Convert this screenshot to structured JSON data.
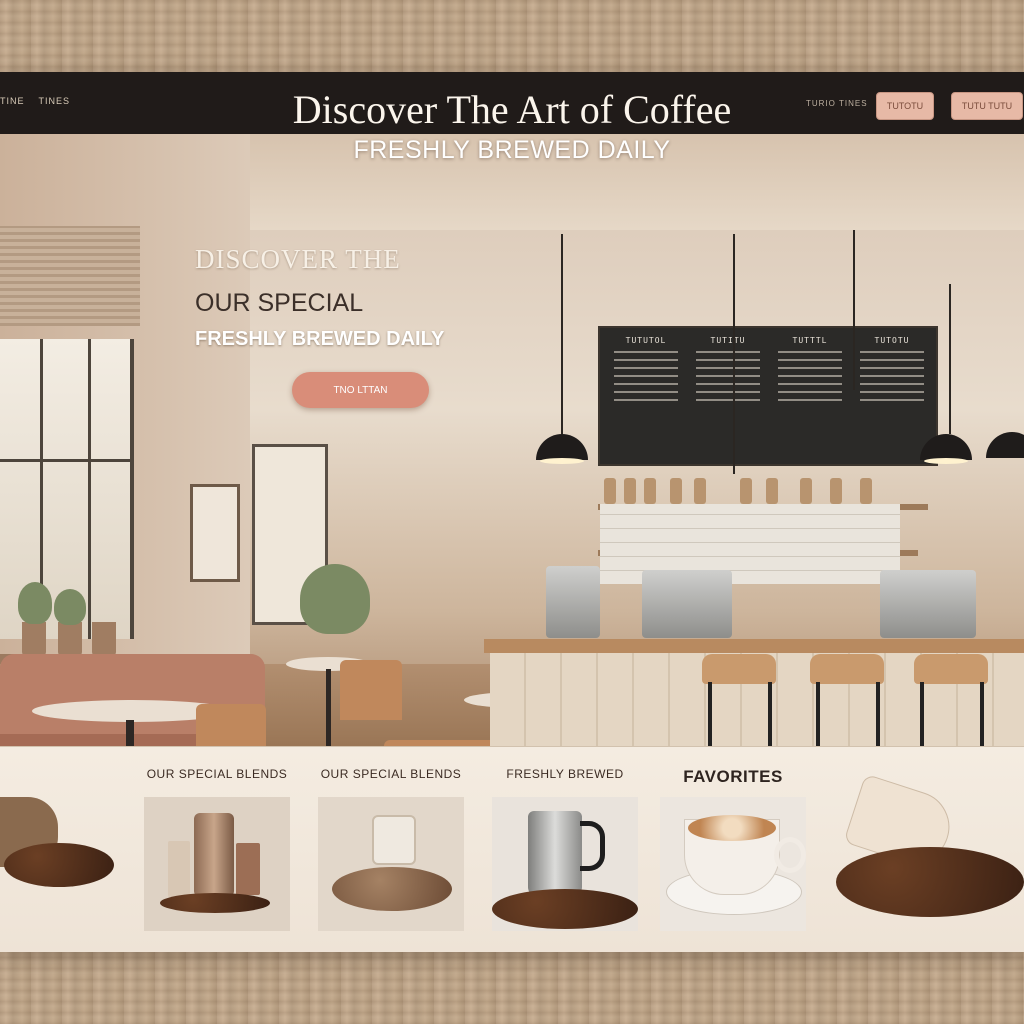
{
  "header": {
    "title": "Discover The Art of Coffee",
    "subtitle": "FRESHLY BREWED DAILY",
    "nav_left": [
      "TINE",
      "TINES"
    ],
    "nav_right_text": "TURIO TINES",
    "button_a_label": "TUTOTU",
    "button_b_label": "TUTU TUTU"
  },
  "hero": {
    "heading": "DISCOVER THE",
    "tagline": "OUR SPECIAL",
    "tagline2": "FRESHLY BREWED DAILY",
    "cta_label": "TNO LTTAN"
  },
  "menu_board": {
    "columns": [
      "TUTUTOL",
      "TUTITU",
      "TUTTTL",
      "TUTOTU"
    ]
  },
  "products": [
    {
      "title": "OUR SPECIAL BLENDS",
      "icon": "coffee-tin-icon"
    },
    {
      "title": "OUR SPECIAL BLENDS",
      "icon": "coffee-jar-icon"
    },
    {
      "title": "FRESHLY BREWED",
      "icon": "pitcher-icon"
    },
    {
      "title": "FAVORITES",
      "icon": "latte-cup-icon"
    }
  ],
  "colors": {
    "topbar": "#201b19",
    "accent": "#d98d79",
    "page_bg": "#efe4d6"
  }
}
